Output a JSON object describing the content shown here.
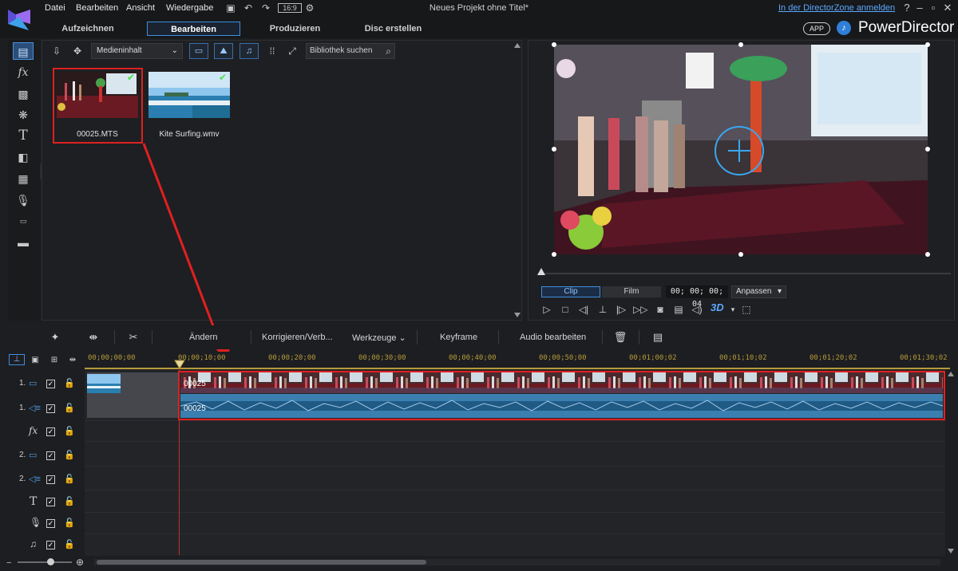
{
  "menu": [
    "Datei",
    "Bearbeiten",
    "Ansicht",
    "Wiedergabe"
  ],
  "aspect_ratio": "16:9",
  "project_title": "Neues Projekt ohne Titel*",
  "directorzone_link": "In der DirectorZone anmelden",
  "window_controls": [
    "?",
    "–",
    "▫",
    "✕"
  ],
  "modes": [
    "Aufzeichnen",
    "Bearbeiten",
    "Produzieren",
    "Disc erstellen"
  ],
  "active_mode": "Bearbeiten",
  "app_badge": "APP",
  "brand": "PowerDirector",
  "library": {
    "media_select": "Medieninhalt",
    "search_placeholder": "Bibliothek suchen",
    "items": [
      {
        "label": "00025.MTS",
        "checked": true,
        "selected": true
      },
      {
        "label": "Kite Surfing.wmv",
        "checked": true,
        "selected": false
      }
    ]
  },
  "preview": {
    "clip_tab": "Clip",
    "film_tab": "Film",
    "timecode": "00; 00; 00; 04",
    "fit_select": "Anpassen",
    "stereo_label": "3D"
  },
  "timeline_toolbar": {
    "change": "Ändern",
    "correct": "Korrigieren/Verb...",
    "tools": "Werkzeuge",
    "keyframe": "Keyframe",
    "audio_edit": "Audio bearbeiten"
  },
  "ruler_timecodes": [
    "00;00;00;00",
    "00;00;10;00",
    "00;00;20;00",
    "00;00;30;00",
    "00;00;40;00",
    "00;00;50;00",
    "00;01;00;02",
    "00;01;10;02",
    "00;01;20;02",
    "00;01;30;02"
  ],
  "tracks": [
    {
      "num": "1.",
      "type": "video"
    },
    {
      "num": "1.",
      "type": "audio"
    },
    {
      "num": "",
      "type": "fx"
    },
    {
      "num": "2.",
      "type": "video"
    },
    {
      "num": "2.",
      "type": "audio"
    },
    {
      "num": "",
      "type": "title"
    },
    {
      "num": "",
      "type": "voice"
    },
    {
      "num": "",
      "type": "music"
    }
  ],
  "clips": {
    "video_label": "00025",
    "audio_label": "00025"
  },
  "colors": {
    "accent": "#3d8fe0",
    "highlight_box": "#e02020",
    "playhead": "#c0302a",
    "ruler": "#b59a3a",
    "audio_clip": "#2f6ea0"
  }
}
